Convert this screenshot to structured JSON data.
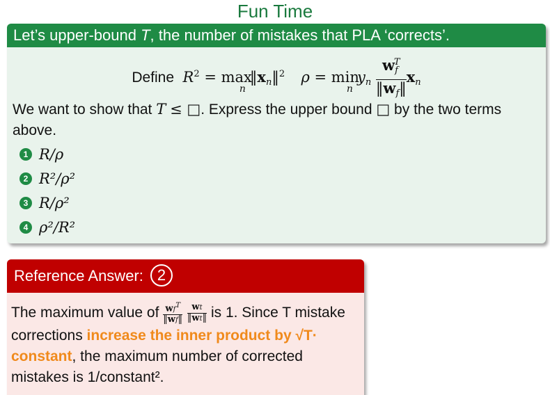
{
  "title": "Fun Time",
  "box_header": "Let’s upper-bound T, the number of mistakes that PLA ‘corrects’.",
  "define_label": "Define",
  "question_line": "We want to show that T ≤ □. Express the upper bound □ by the two terms above.",
  "options": [
    {
      "number": "1",
      "text": "R/ρ"
    },
    {
      "number": "2",
      "text": "R²/ρ²"
    },
    {
      "number": "3",
      "text": "R/ρ²"
    },
    {
      "number": "4",
      "text": "ρ²/R²"
    }
  ],
  "answer_header": "Reference Answer:",
  "answer_number": "2",
  "answer_text": {
    "p1": "The maximum value of",
    "p2": "is 1. Since T mistake corrections",
    "highlight": "increase the inner product by √T· constant",
    "p3": ", the maximum number of corrected mistakes is 1/constant²."
  },
  "colors": {
    "green": "#1f8b45",
    "red": "#c00000",
    "orange": "#f08a1c"
  }
}
